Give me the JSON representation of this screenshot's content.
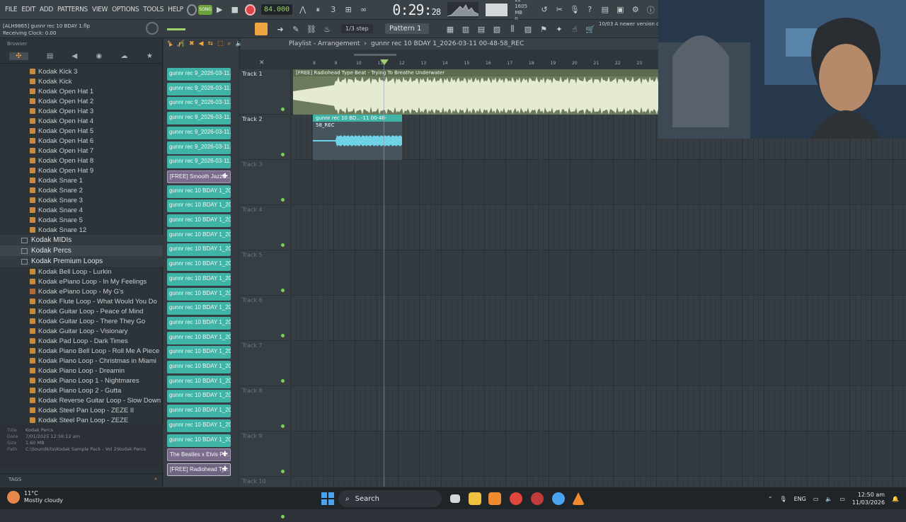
{
  "menu": [
    "FILE",
    "EDIT",
    "ADD",
    "PATTERNS",
    "VIEW",
    "OPTIONS",
    "TOOLS",
    "HELP"
  ],
  "transport": {
    "song_label": "SONG",
    "tempo": "84.000",
    "time_main": "0:29",
    "time_sub": "28",
    "time_unit": "M:S:CS",
    "cpu_top": "22",
    "memory": "1605 MB",
    "cpu_bottom": "0"
  },
  "project": {
    "file_line": "[ALH9865] gunnr rec 10 BDAY 1.flp",
    "status_line": "Receiving Clock: 0.00"
  },
  "toolbar2": {
    "step": "1/3 step",
    "pattern": "Pattern 1",
    "notice_date": "10/03",
    "notice_text": "A newer version of FL Studio is available!"
  },
  "browser": {
    "title": "Browser",
    "items_top": [
      "Kodak Kick 3",
      "Kodak Kick",
      "Kodak Open Hat 1",
      "Kodak Open Hat 2",
      "Kodak Open Hat 3",
      "Kodak Open Hat 4",
      "Kodak Open Hat 5",
      "Kodak Open Hat 6",
      "Kodak Open Hat 7",
      "Kodak Open Hat 8",
      "Kodak Open Hat 9",
      "Kodak Snare 1",
      "Kodak Snare 2",
      "Kodak Snare 3",
      "Kodak Snare 4",
      "Kodak Snare 5",
      "Kodak Snare 12"
    ],
    "folders": [
      "Kodak MIDIs",
      "Kodak Percs",
      "Kodak Premium Loops"
    ],
    "items_loops": [
      "Kodak Bell Loop - Lurkin",
      "Kodak ePiano Loop - In My Feelings",
      "Kodak ePiano Loop - My G's",
      "Kodak Flute Loop - What Would You Do",
      "Kodak Guitar Loop - Peace of Mind",
      "Kodak Guitar Loop - There They Go",
      "Kodak Guitar Loop - Visionary",
      "Kodak Pad Loop - Dark Times",
      "Kodak Piano Bell Loop - Roll Me A Piece",
      "Kodak Piano Loop - Christmas in Miami",
      "Kodak Piano Loop - Dreamin",
      "Kodak Piano Loop 1 - Nightmares",
      "Kodak Piano Loop 2 - Gutta",
      "Kodak Reverse Guitar Loop - Slow Down",
      "Kodak Steel Pan Loop - ZEZE II",
      "Kodak Steel Pan Loop - ZEZE"
    ],
    "file_info": {
      "title_label": "Title",
      "title": "Kodak Percs",
      "date_label": "Date",
      "date": "7/01/2025 12:56:12 am",
      "size_label": "Size",
      "size": "1.60 MB",
      "path_label": "Path",
      "path": "C:\\Soundkits\\Kodak Sample Pack - Vol 2\\Kodak Percs"
    },
    "tags_label": "TAGS"
  },
  "picker": {
    "clips": [
      "gunnr rec 9_2026-03-11...",
      "gunnr rec 9_2026-03-11...",
      "gunnr rec 9_2026-03-11...",
      "gunnr rec 9_2026-03-11...",
      "gunnr rec 9_2026-03-11...",
      "gunnr rec 9_2026-03-11...",
      "gunnr rec 9_2026-03-11...",
      "[FREE] Smooth JazzB...",
      "gunnr rec 10 BDAY 1_202...",
      "gunnr rec 10 BDAY 1_202...",
      "gunnr rec 10 BDAY 1_202...",
      "gunnr rec 10 BDAY 1_202...",
      "gunnr rec 10 BDAY 1_202...",
      "gunnr rec 10 BDAY 1_202...",
      "gunnr rec 10 BDAY 1_202...",
      "gunnr rec 10 BDAY 1_202...",
      "gunnr rec 10 BDAY 1_202...",
      "gunnr rec 10 BDAY 1_202...",
      "gunnr rec 10 BDAY 1_202...",
      "gunnr rec 10 BDAY 1_202...",
      "gunnr rec 10 BDAY 1_202...",
      "gunnr rec 10 BDAY 1_202...",
      "gunnr rec 10 BDAY 1_202...",
      "gunnr rec 10 BDAY 1_202...",
      "gunnr rec 10 BDAY 1_202...",
      "gunnr rec 10 BDAY 1_202...",
      "The Beatles x Elvis Pr...",
      "[FREE] Radiohead Ty..."
    ]
  },
  "playlist": {
    "title": "Playlist - Arrangement",
    "breadcrumb": "gunnr rec 10 BDAY 1_2026-03-11 00-48-58_REC",
    "bars": [
      "8",
      "9",
      "10",
      "11",
      "12",
      "13",
      "14",
      "15",
      "16",
      "17",
      "18",
      "19",
      "20",
      "21",
      "22",
      "23"
    ],
    "tracks": [
      "Track 1",
      "Track 2",
      "Track 3",
      "Track 4",
      "Track 5",
      "Track 6",
      "Track 7",
      "Track 8",
      "Track 9",
      "Track 10"
    ],
    "clip1_title": "[FREE] Radiohead Type Beat - Trying To Breathe Underwater",
    "clip2_title": "gunnr rec 10 BD...-11 00-48-58_REC"
  },
  "taskbar": {
    "temp": "11°C",
    "weather": "Mostly cloudy",
    "search": "Search",
    "lang": "ENG",
    "time": "12:50 am",
    "date": "11/03/2026"
  },
  "colors": {
    "accent": "#f0a640",
    "audio_clip": "#3fb3a6",
    "record": "#e0444a",
    "song_mode": "#6ca33c"
  }
}
